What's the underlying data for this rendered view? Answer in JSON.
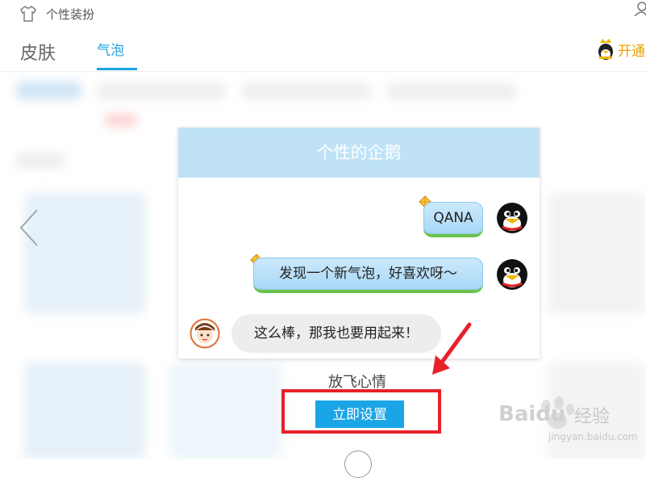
{
  "window": {
    "title": "个性装扮"
  },
  "tabs": [
    {
      "label": "皮肤",
      "active": false
    },
    {
      "label": "气泡",
      "active": true
    }
  ],
  "header_action": {
    "label": "开通"
  },
  "preview": {
    "title": "个性的企鹅",
    "messages": [
      {
        "text": "QANA",
        "side": "right"
      },
      {
        "text": "发现一个新气泡，好喜欢呀～",
        "side": "right"
      },
      {
        "text": "这么棒，那我也要用起来！",
        "side": "left"
      }
    ]
  },
  "bubble_name": "放飞心情",
  "apply_button": {
    "label": "立即设置"
  },
  "watermark": {
    "brand": "Bai",
    "brand2": "du",
    "cn": "经验",
    "url": "jingyan.baidu.com"
  },
  "colors": {
    "accent": "#1aa5e6",
    "highlight": "#e8202a",
    "header": "#bfe2f7"
  }
}
